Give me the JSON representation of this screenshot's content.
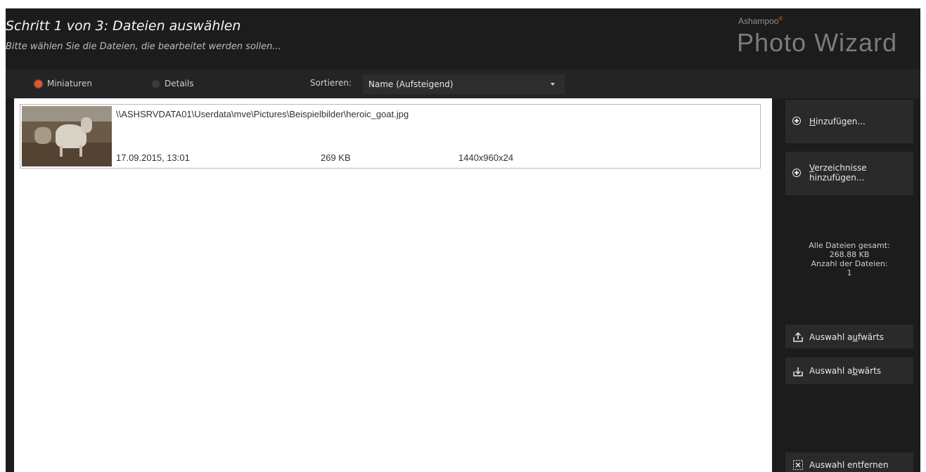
{
  "header": {
    "title": "Schritt 1 von 3: Dateien auswählen",
    "subtitle": "Bitte wählen Sie die Dateien, die bearbeitet werden sollen...",
    "brand_top": "Ashampoo",
    "brand_mark": "®",
    "brand_name": "Photo Wizard"
  },
  "toolbar": {
    "view_options": [
      {
        "label": "Miniaturen",
        "selected": true
      },
      {
        "label": "Details",
        "selected": false
      }
    ],
    "sort_label": "Sortieren:",
    "sort_value": "Name (Aufsteigend)"
  },
  "files": [
    {
      "path": "\\\\ASHSRVDATA01\\Userdata\\mve\\Pictures\\Beispielbilder\\heroic_goat.jpg",
      "date": "17.09.2015, 13:01",
      "size": "269 KB",
      "dimensions": "1440x960x24"
    }
  ],
  "sidebar": {
    "add_files": {
      "mnemonic": "H",
      "rest": "inzufügen..."
    },
    "add_dirs": {
      "mnemonic": "V",
      "line1_rest": "erzeichnisse",
      "line2": "hinzufügen..."
    },
    "stats": {
      "total_label": "Alle Dateien gesamt:",
      "total_value": "268.88 KB",
      "count_label": "Anzahl der Dateien:",
      "count_value": "1"
    },
    "move_up": {
      "prefix": "Auswahl a",
      "mnemonic": "u",
      "rest": "fwärts"
    },
    "move_down": {
      "prefix": "Auswahl a",
      "mnemonic": "b",
      "rest": "wärts"
    },
    "remove": {
      "label": "Auswahl entfernen"
    }
  },
  "colors": {
    "accent": "#e8552b",
    "background": "#1c1c1c",
    "panel": "#2a2a2a"
  }
}
